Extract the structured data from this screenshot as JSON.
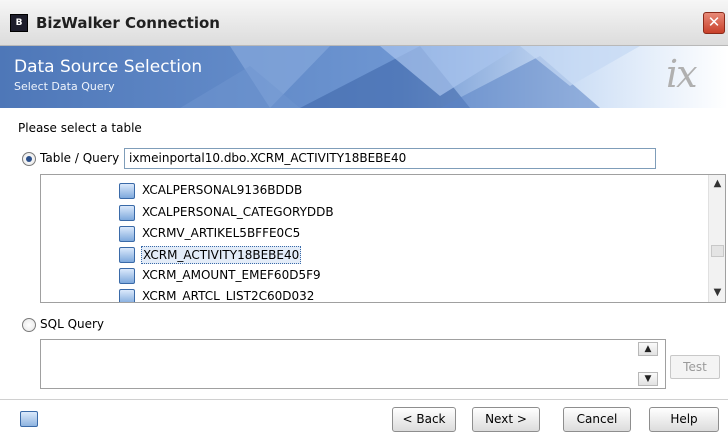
{
  "window": {
    "title": "BizWalker Connection",
    "app_icon": "bizwalker-app-icon",
    "close_icon": "close-icon"
  },
  "banner": {
    "title": "Data Source Selection",
    "subtitle": "Select Data Query",
    "logo_text": "ix",
    "colors": {
      "primary": "#5a82c0",
      "light": "#a6c3ea",
      "dark": "#3d66a8"
    }
  },
  "prompt": "Please select a table",
  "table_query": {
    "label": "Table / Query",
    "selected": true,
    "value": "ixmeinportal10.dbo.XCRM_ACTIVITY18BEBE40"
  },
  "tables": [
    {
      "name": "XCALPERSONAL9136BDDB",
      "icon": "table-icon",
      "selected": false
    },
    {
      "name": "XCALPERSONAL_CATEGORYDDB",
      "icon": "table-icon",
      "selected": false
    },
    {
      "name": "XCRMV_ARTIKEL5BFFE0C5",
      "icon": "table-icon",
      "selected": false
    },
    {
      "name": "XCRM_ACTIVITY18BEBE40",
      "icon": "table-icon",
      "selected": true
    },
    {
      "name": "XCRM_AMOUNT_EMEF60D5F9",
      "icon": "table-icon",
      "selected": false
    },
    {
      "name": "XCRM_ARTCL_LIST2C60D032",
      "icon": "table-icon",
      "selected": false
    }
  ],
  "sql_query": {
    "label": "SQL Query",
    "selected": false,
    "value": ""
  },
  "buttons": {
    "test": "Test",
    "back": "< Back",
    "next": "Next >",
    "cancel": "Cancel",
    "help": "Help"
  },
  "footer_icon": "connection-icon"
}
